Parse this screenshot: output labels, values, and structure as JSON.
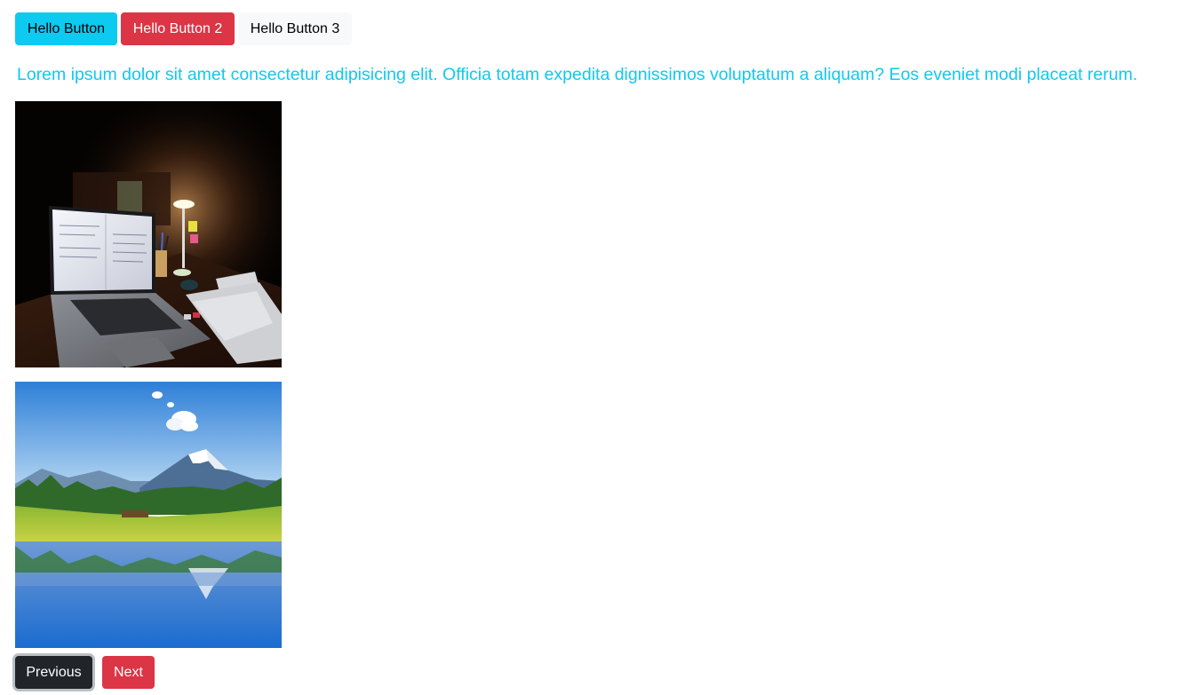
{
  "toolbar": {
    "hello_button_label": "Hello Button",
    "hello_button_2_label": "Hello Button 2",
    "hello_button_3_label": "Hello Button 3"
  },
  "content": {
    "lead_text": "Lorem ipsum dolor sit amet consectetur adipisicing elit. Officia totam expedita dignissimos voluptatum a aliquam? Eos eveniet modi placeat rerum."
  },
  "images": [
    {
      "subject": "laptop on desk with lamp at night"
    },
    {
      "subject": "mountain lake landscape with reflection"
    }
  ],
  "pagination": {
    "previous_label": "Previous",
    "next_label": "Next"
  },
  "colors": {
    "info": "#0dcaf0",
    "danger": "#dc3545",
    "light": "#f8f9fa",
    "dark": "#212529"
  }
}
